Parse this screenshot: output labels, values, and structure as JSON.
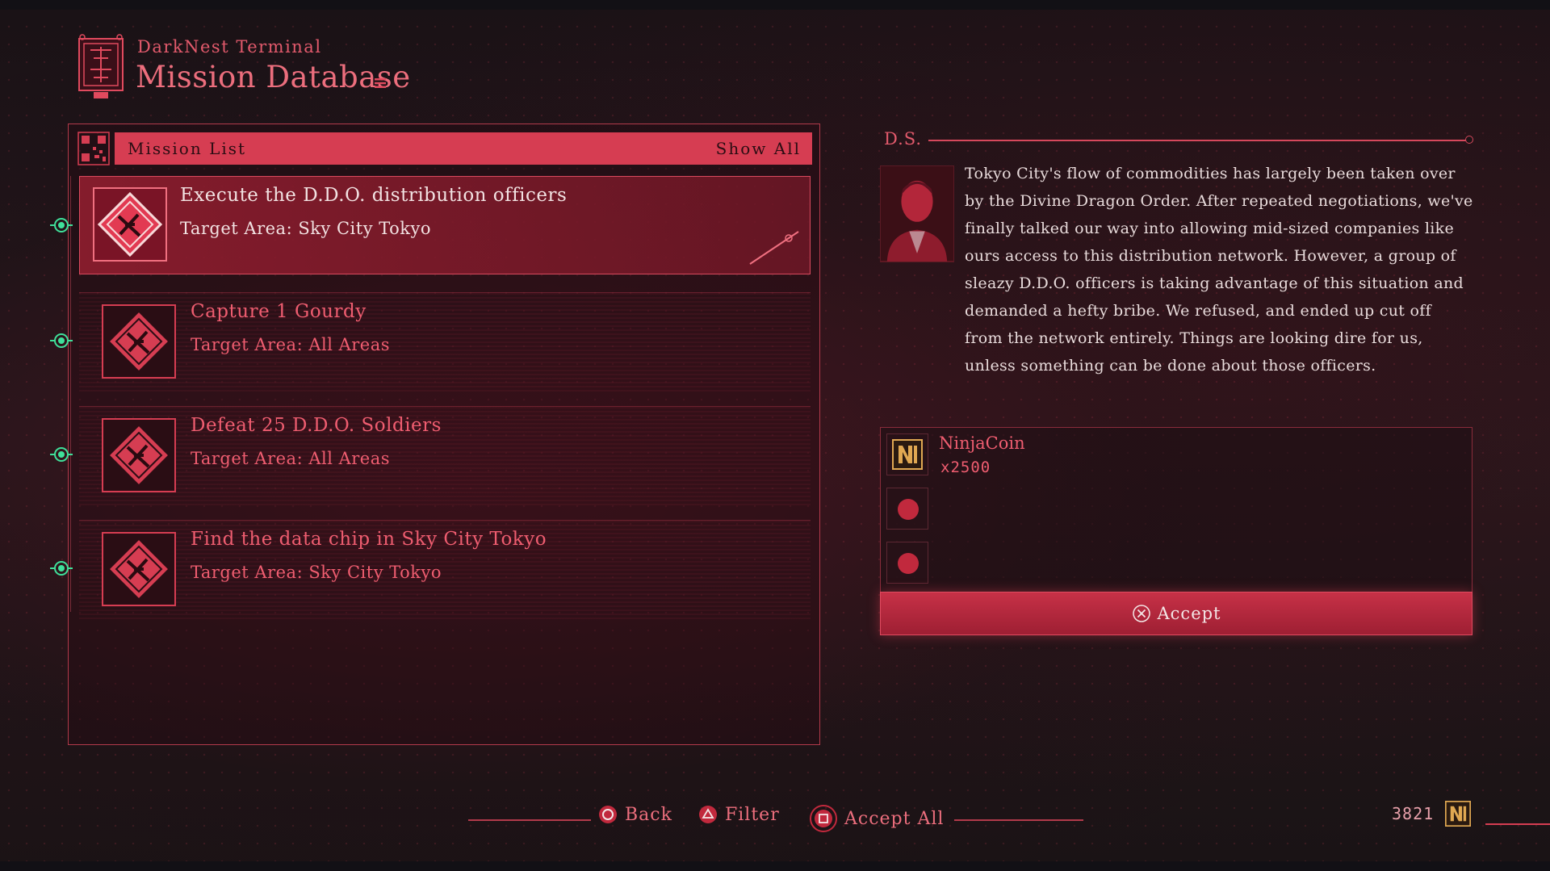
{
  "header": {
    "subtitle": "DarkNest Terminal",
    "title": "Mission Database"
  },
  "mission_list": {
    "title": "Mission List",
    "filter_label": "Show All",
    "items": [
      {
        "title": "Execute the D.D.O. distribution officers",
        "area": "Target Area: Sky City Tokyo",
        "selected": true
      },
      {
        "title": "Capture 1 Gourdy",
        "area": "Target Area: All Areas",
        "selected": false
      },
      {
        "title": "Defeat 25 D.D.O. Soldiers",
        "area": "Target Area: All Areas",
        "selected": false
      },
      {
        "title": "Find the data chip in Sky City Tokyo",
        "area": "Target Area: Sky City Tokyo",
        "selected": false
      }
    ]
  },
  "detail": {
    "client": "D.S.",
    "description": "Tokyo City's flow of commodities has largely been taken over by the Divine Dragon Order. After repeated negotiations, we've finally talked our way into allowing mid-sized companies like ours access to this distribution network. However, a group of sleazy D.D.O. officers is taking advantage of this situation and demanded a hefty bribe. We refused, and ended up cut off from the network entirely. Things are looking dire for us, unless something can be done about those officers.",
    "reward": {
      "name": "NinjaCoin",
      "quantity": "x2500"
    },
    "accept_label": "Accept"
  },
  "footer": {
    "back_label": "Back",
    "filter_label": "Filter",
    "accept_all_label": "Accept All",
    "currency_amount": "3821"
  },
  "colors": {
    "accent": "#d63d52",
    "accent_text": "#ef5d70",
    "background": "#1c1417",
    "node_green": "#3fe09a"
  }
}
